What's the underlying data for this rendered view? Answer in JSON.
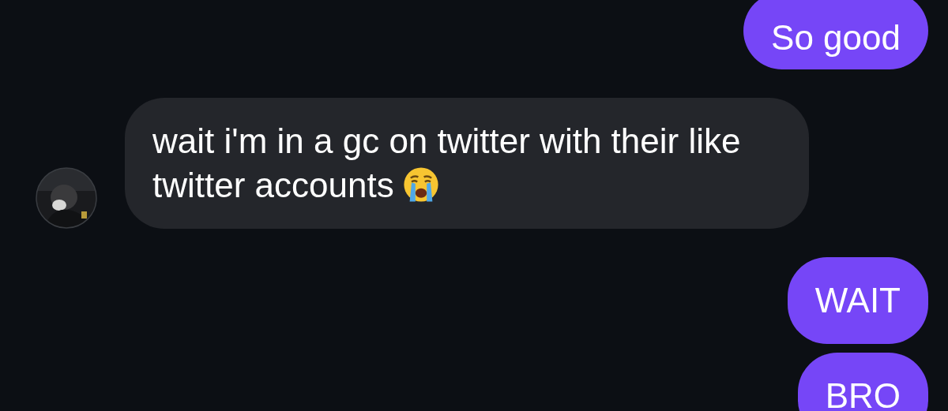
{
  "messages": [
    {
      "kind": "outgoing",
      "text": "So good"
    },
    {
      "kind": "incoming",
      "text": "wait i'm in a gc on twitter with their like twitter accounts",
      "emoji": true
    },
    {
      "kind": "outgoing",
      "text": "WAIT"
    },
    {
      "kind": "outgoing",
      "text": "BRO"
    }
  ]
}
